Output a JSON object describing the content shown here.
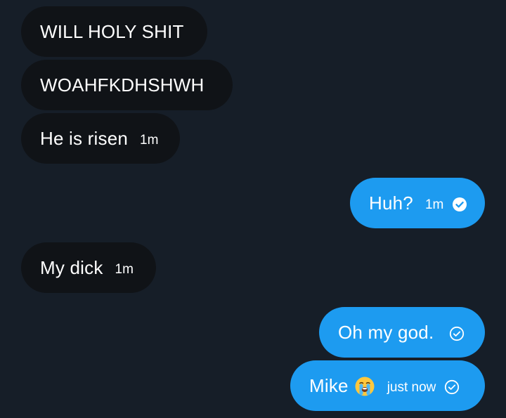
{
  "messages": [
    {
      "text": "WILL HOLY SHIT",
      "time": ""
    },
    {
      "text": "WOAHFKDHSHWH",
      "time": ""
    },
    {
      "text": "He is risen",
      "time": "1m"
    },
    {
      "text": "Huh?",
      "time": "1m",
      "status_icon": "read-check-icon"
    },
    {
      "text": "My dick",
      "time": "1m"
    },
    {
      "text": "Oh my god.",
      "time": "",
      "status_icon": "sent-check-icon"
    },
    {
      "text": "Mike",
      "emoji": "loudly-crying-face-icon",
      "time": "just now",
      "status_icon": "sent-check-icon"
    }
  ],
  "colors": {
    "background": "#161e28",
    "incoming_bubble": "#101317",
    "outgoing_bubble": "#1d9bf0",
    "text": "#ffffff"
  }
}
